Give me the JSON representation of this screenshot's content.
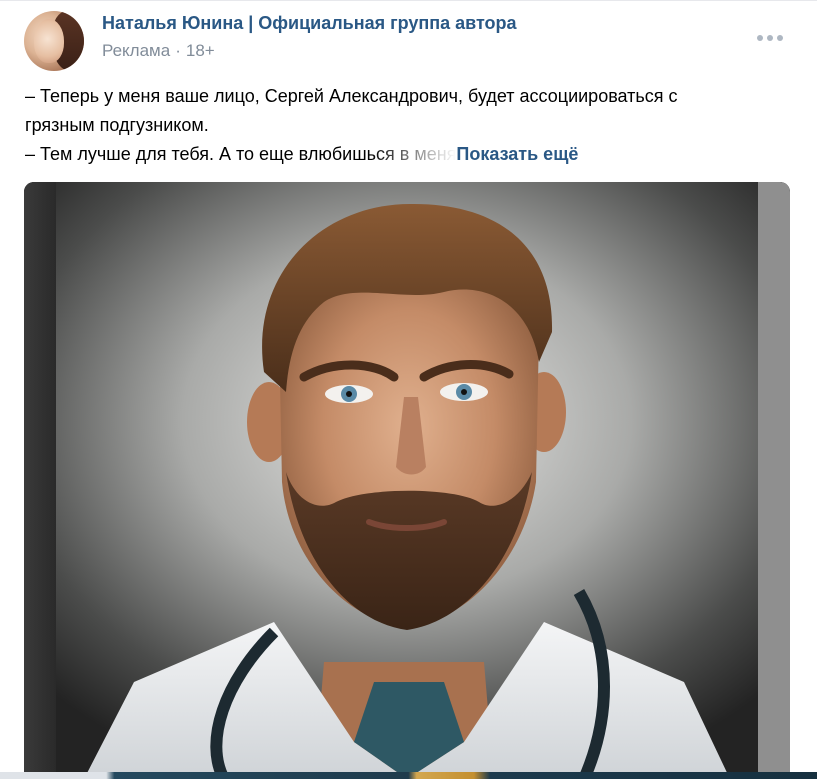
{
  "post": {
    "author": "Наталья Юнина | Официальная группа автора",
    "label": "Реклама",
    "separator": "·",
    "age_rating": "18+",
    "text_line1": "– Теперь у меня ваше лицо, Сергей Александрович, будет ассоциироваться с",
    "text_line2": "грязным подгузником.",
    "text_line3": "– Тем лучше для тебя. А то еще влюбишься в меня",
    "show_more": "Показать ещё",
    "more_icon": "ellipsis-icon",
    "photo_subject": "portrait of a bearded man in a white doctor's coat with stethoscope"
  },
  "colors": {
    "link": "#2a5885",
    "meta": "#818c99",
    "background": "#ffffff"
  }
}
